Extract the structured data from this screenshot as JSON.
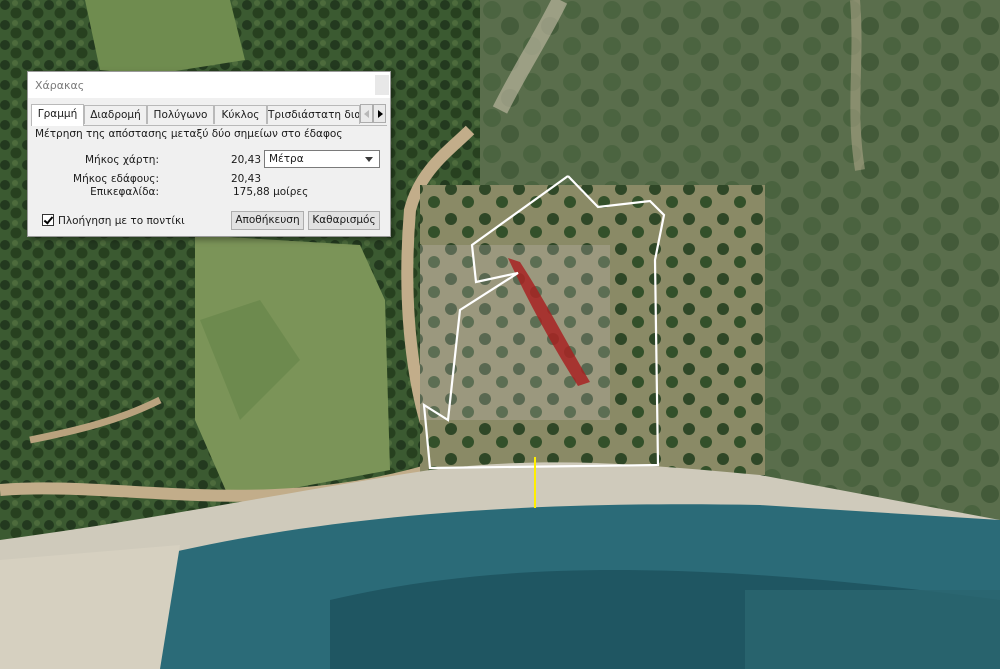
{
  "dialog": {
    "title": "Χάρακας",
    "tabs": [
      {
        "label": "Γραμμή"
      },
      {
        "label": "Διαδρομή"
      },
      {
        "label": "Πολύγωνο"
      },
      {
        "label": "Κύκλος"
      },
      {
        "label": "Τρισδιάστατη διαδρ"
      }
    ],
    "active_tab": "Γραμμή",
    "description": "Μέτρηση της απόστασης μεταξύ δύο σημείων στο έδαφος",
    "map_length": {
      "label": "Μήκος χάρτη:",
      "value": "20,43"
    },
    "ground_length": {
      "label": "Μήκος εδάφους:",
      "value": "20,43"
    },
    "heading": {
      "label": "Επικεφαλίδα:",
      "value": "175,88 μοίρες"
    },
    "unit_select": {
      "value": "Μέτρα"
    },
    "mouse_nav": {
      "label": "Πλοήγηση με το ποντίκι",
      "checked": true
    },
    "save_button": "Αποθήκευση",
    "clear_button": "Καθαρισμός"
  },
  "colors": {
    "polygon_outline": "#ffffff",
    "ruler_line": "#ffee00",
    "highlight_region": "#a81f1f"
  }
}
